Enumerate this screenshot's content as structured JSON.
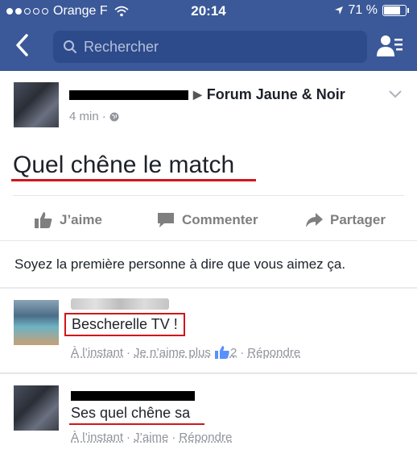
{
  "status_bar": {
    "carrier": "Orange F",
    "time": "20:14",
    "battery": "71 %",
    "battery_level": 0.71,
    "signal_bars": 2
  },
  "header": {
    "search_placeholder": "Rechercher"
  },
  "post": {
    "group": "Forum Jaune & Noir",
    "time": "4 min",
    "text": "Quel chêne le match"
  },
  "actions": {
    "like": "J’aime",
    "comment": "Commenter",
    "share": "Partager"
  },
  "likes_summary": "Soyez la première personne à dire que vous aimez ça.",
  "comments": [
    {
      "text": "Bescherelle TV !",
      "time": "À l’instant",
      "action": "Je n’aime plus",
      "like_count": "2",
      "reply": "Répondre"
    },
    {
      "text": "Ses quel chêne sa",
      "time": "À l’instant",
      "action": "J’aime",
      "reply": "Répondre"
    }
  ],
  "colors": {
    "header": "#3b5998",
    "highlight": "#d0161b"
  }
}
